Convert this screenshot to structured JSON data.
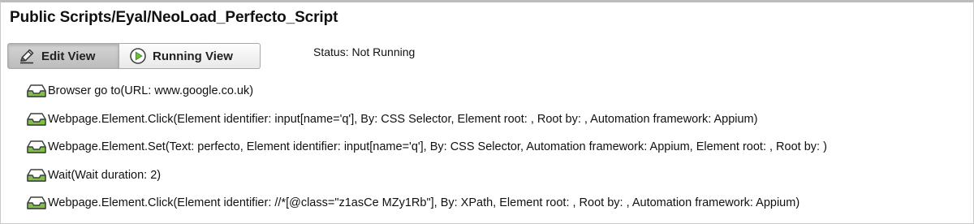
{
  "header": {
    "title": "Public Scripts/Eyal/NeoLoad_Perfecto_Script"
  },
  "toolbar": {
    "edit_view_label": "Edit View",
    "running_view_label": "Running View",
    "status_text": "Status: Not Running"
  },
  "steps": [
    {
      "label": "Browser go to(URL: www.google.co.uk)",
      "icon": "tray-icon"
    },
    {
      "label": "Webpage.Element.Click(Element identifier: input[name='q'], By: CSS Selector, Element root: , Root by: , Automation framework: Appium)",
      "icon": "tray-icon"
    },
    {
      "label": "Webpage.Element.Set(Text: perfecto, Element identifier: input[name='q'], By: CSS Selector, Automation framework: Appium, Element root: , Root by: )",
      "icon": "tray-icon"
    },
    {
      "label": "Wait(Wait duration: 2)",
      "icon": "tray-icon"
    },
    {
      "label": "Webpage.Element.Click(Element identifier: //*[@class=\"z1asCe MZy1Rb\"], By: XPath, Element root: , Root by: , Automation framework: Appium)",
      "icon": "tray-icon"
    }
  ],
  "colors": {
    "tray_fill": "#7fbf4a",
    "tray_stroke": "#3e3e3e",
    "play_green": "#6cbf3a"
  }
}
